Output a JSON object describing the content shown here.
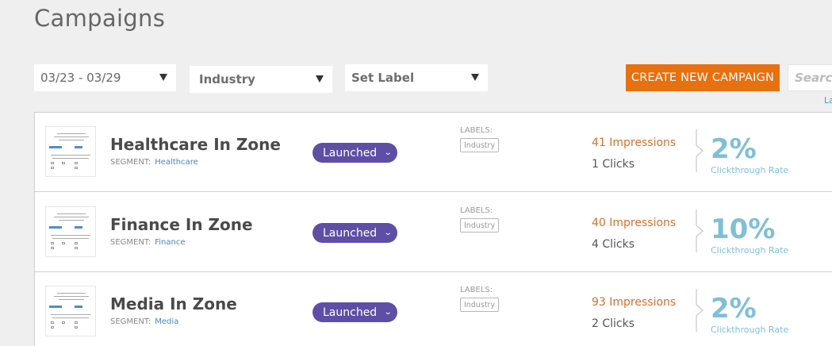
{
  "header": {
    "title": "Campaigns"
  },
  "filters": {
    "date_range": "03/23 - 03/29",
    "industry": "Industry",
    "set_label": "Set Label"
  },
  "toolbar": {
    "create_label": "CREATE NEW CAMPAIGN",
    "search_placeholder": "Search",
    "link_text": "La"
  },
  "campaigns": [
    {
      "name": "Healthcare In Zone",
      "segment_label": "SEGMENT:",
      "segment": "Healthcare",
      "status": "Launched",
      "labels_title": "LABELS:",
      "label": "Industry",
      "impressions": "41 Impressions",
      "clicks": "1 Clicks",
      "rate": "2%",
      "rate_label": "Clickthrough Rate"
    },
    {
      "name": "Finance In Zone",
      "segment_label": "SEGMENT:",
      "segment": "Finance",
      "status": "Launched",
      "labels_title": "LABELS:",
      "label": "Industry",
      "impressions": "40 Impressions",
      "clicks": "4 Clicks",
      "rate": "10%",
      "rate_label": "Clickthrough Rate"
    },
    {
      "name": "Media In Zone",
      "segment_label": "SEGMENT:",
      "segment": "Media",
      "status": "Launched",
      "labels_title": "LABELS:",
      "label": "Industry",
      "impressions": "93 Impressions",
      "clicks": "2 Clicks",
      "rate": "2%",
      "rate_label": "Clickthrough Rate"
    }
  ],
  "colors": {
    "accent": "#e8700f",
    "status": "#5f4ea6",
    "rate": "#7fbfd8",
    "impressions": "#d2712e"
  }
}
